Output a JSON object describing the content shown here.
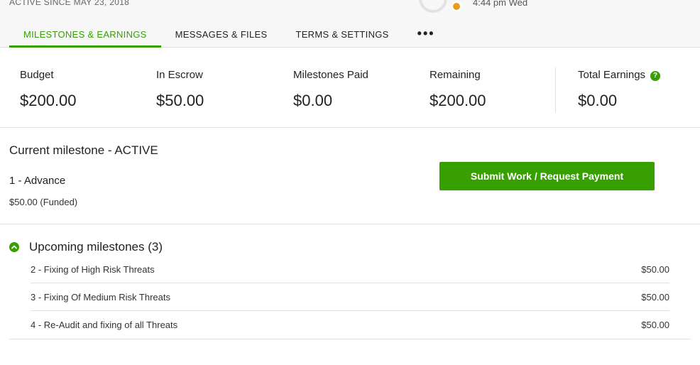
{
  "header": {
    "active_since": "ACTIVE SINCE MAY 23, 2018",
    "local_time": "4:44 pm Wed"
  },
  "tabs": [
    {
      "label": "MILESTONES & EARNINGS",
      "active": true
    },
    {
      "label": "MESSAGES & FILES",
      "active": false
    },
    {
      "label": "TERMS & SETTINGS",
      "active": false
    },
    {
      "label": "•••",
      "active": false
    }
  ],
  "stats": {
    "budget": {
      "label": "Budget",
      "value": "$200.00"
    },
    "escrow": {
      "label": "In Escrow",
      "value": "$50.00"
    },
    "paid": {
      "label": "Milestones Paid",
      "value": "$0.00"
    },
    "remaining": {
      "label": "Remaining",
      "value": "$200.00"
    },
    "earnings": {
      "label": "Total Earnings",
      "value": "$0.00",
      "help_icon": "?"
    }
  },
  "current_milestone": {
    "title": "Current milestone - ACTIVE",
    "name": "1 - Advance",
    "amount": "$50.00 (Funded)",
    "submit_label": "Submit Work / Request Payment"
  },
  "upcoming": {
    "title": "Upcoming milestones (3)",
    "items": [
      {
        "name": "2 - Fixing of High Risk Threats",
        "amount": "$50.00"
      },
      {
        "name": "3 - Fixing Of Medium Risk Threats",
        "amount": "$50.00"
      },
      {
        "name": "4 - Re-Audit and fixing of all Threats",
        "amount": "$50.00"
      }
    ]
  },
  "colors": {
    "accent": "#37a000",
    "status_dot": "#e89c1c",
    "divider": "#e0e0e0"
  }
}
